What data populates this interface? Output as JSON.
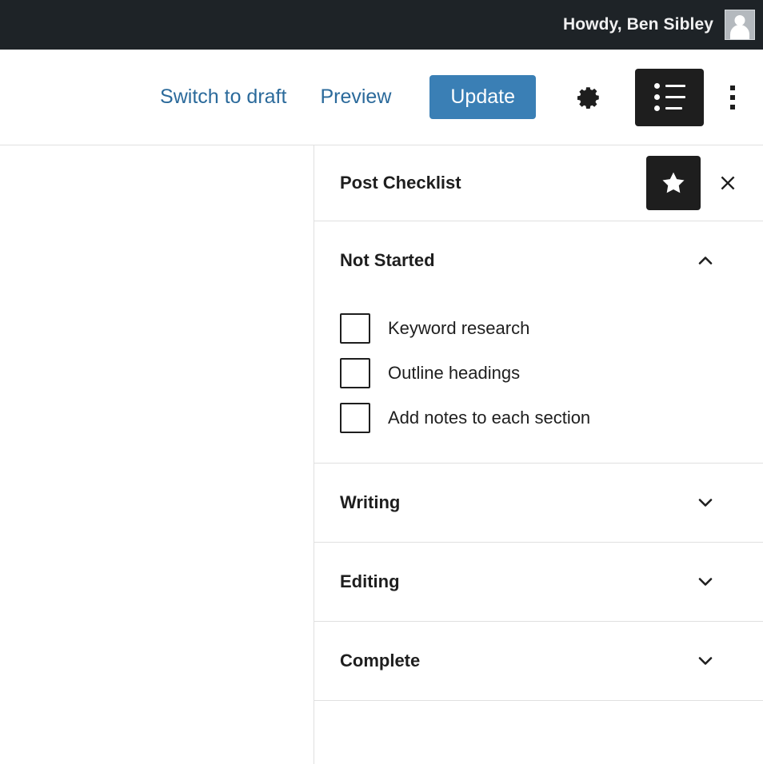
{
  "admin_bar": {
    "greeting": "Howdy, Ben Sibley",
    "avatar_icon": "user-avatar-icon"
  },
  "editor_header": {
    "switch_to_draft_label": "Switch to draft",
    "preview_label": "Preview",
    "update_label": "Update",
    "settings_icon": "gear-icon",
    "checklist_icon": "list-view-icon",
    "more_options_icon": "kebab-menu-icon",
    "accent_blue": "#3a7fb5",
    "link_blue": "#2b6a9b"
  },
  "panel": {
    "title": "Post Checklist",
    "pin_icon": "star-icon",
    "close_icon": "close-x-icon",
    "sections": [
      {
        "label": "Not Started",
        "expanded": true,
        "chevron_icon": "chevron-up-icon",
        "items": [
          {
            "label": "Keyword research",
            "checked": false
          },
          {
            "label": "Outline headings",
            "checked": false
          },
          {
            "label": "Add notes to each section",
            "checked": false
          }
        ]
      },
      {
        "label": "Writing",
        "expanded": false,
        "chevron_icon": "chevron-down-icon",
        "items": []
      },
      {
        "label": "Editing",
        "expanded": false,
        "chevron_icon": "chevron-down-icon",
        "items": []
      },
      {
        "label": "Complete",
        "expanded": false,
        "chevron_icon": "chevron-down-icon",
        "items": []
      }
    ]
  }
}
